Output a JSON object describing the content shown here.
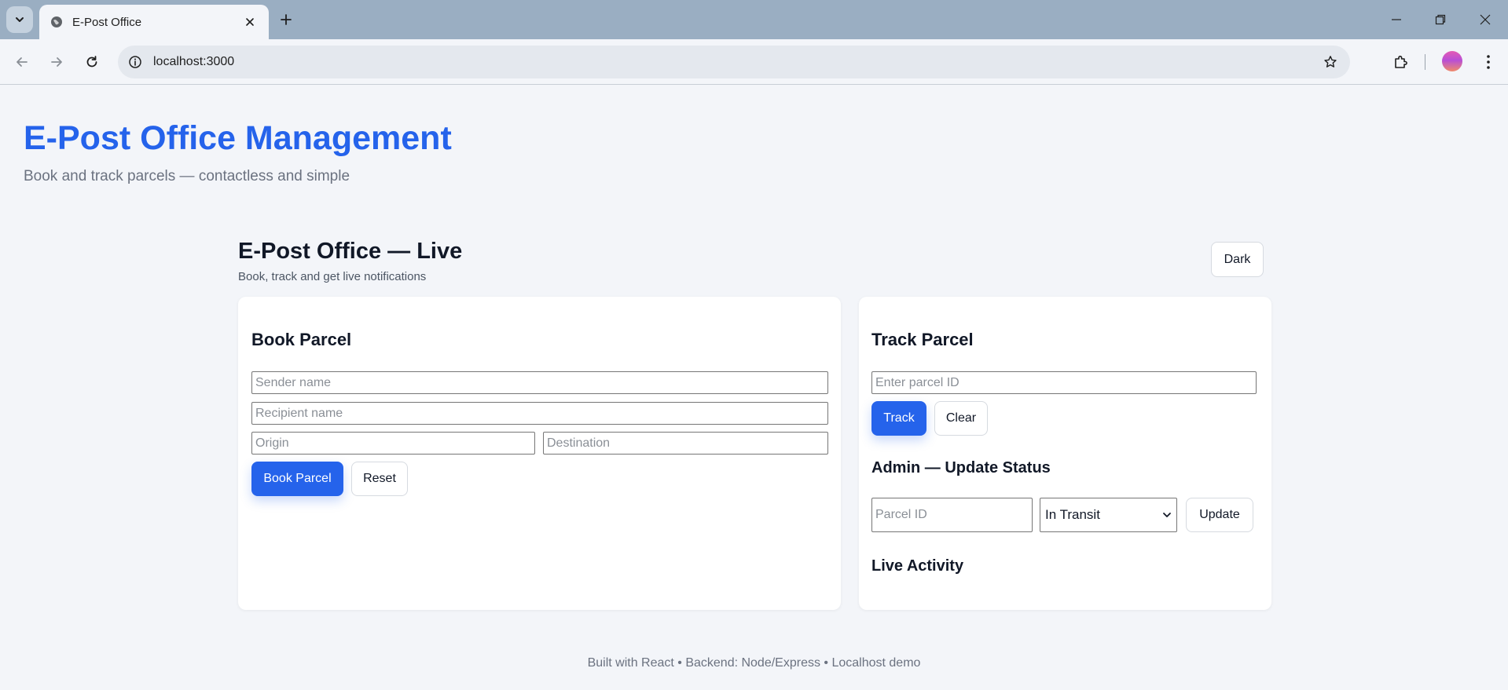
{
  "browser": {
    "tab_title": "E-Post Office",
    "url": "localhost:3000",
    "icons": [
      "tab-search-icon",
      "globe-icon",
      "close-icon",
      "plus-icon",
      "minimize-icon",
      "restore-icon",
      "close-window-icon",
      "back-arrow-icon",
      "forward-arrow-icon",
      "reload-icon",
      "site-info-icon",
      "star-icon",
      "extensions-icon",
      "profile-avatar",
      "more-menu-icon"
    ]
  },
  "header": {
    "title": "E-Post Office Management",
    "subtitle": "Book and track parcels — contactless and simple"
  },
  "app": {
    "title": "E-Post Office — Live",
    "subtitle": "Book, track and get live notifications",
    "theme_button": "Dark"
  },
  "book": {
    "title": "Book Parcel",
    "sender_placeholder": "Sender name",
    "recipient_placeholder": "Recipient name",
    "origin_placeholder": "Origin",
    "destination_placeholder": "Destination",
    "submit_label": "Book Parcel",
    "reset_label": "Reset"
  },
  "track": {
    "title": "Track Parcel",
    "id_placeholder": "Enter parcel ID",
    "track_label": "Track",
    "clear_label": "Clear"
  },
  "admin": {
    "title": "Admin — Update Status",
    "parcel_placeholder": "Parcel ID",
    "status_selected": "In Transit",
    "update_label": "Update"
  },
  "activity": {
    "title": "Live Activity"
  },
  "footer": {
    "text": "Built with React • Backend: Node/Express • Localhost demo"
  },
  "colors": {
    "primary": "#2563eb",
    "page_bg": "#f3f5f9",
    "tabbar_bg": "#9aaec2"
  }
}
